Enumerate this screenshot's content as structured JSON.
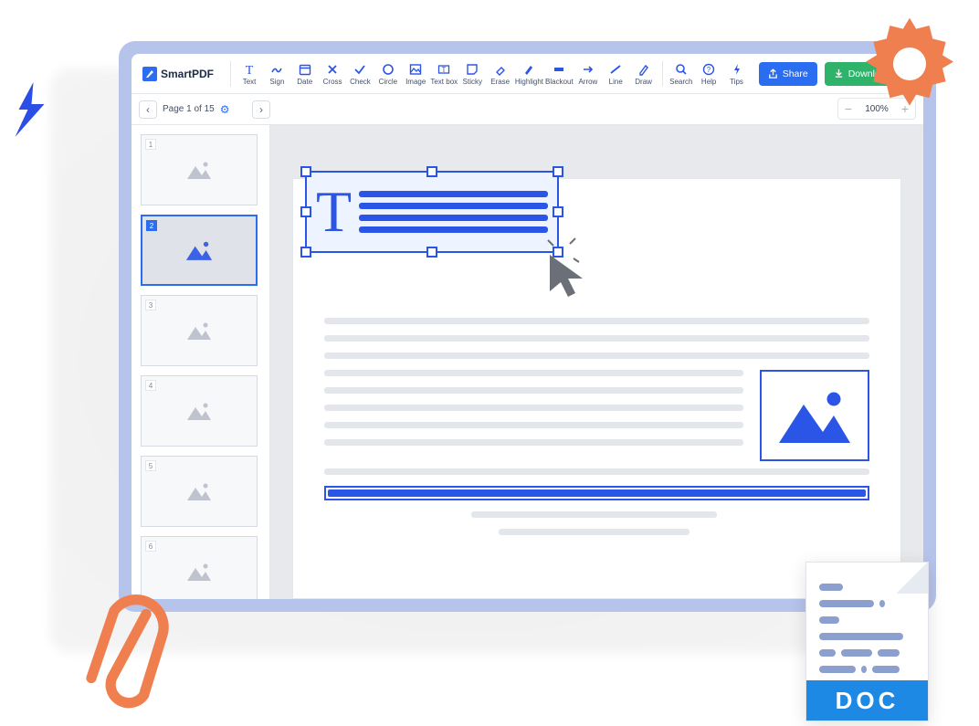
{
  "brand": {
    "name": "SmartPDF"
  },
  "toolbar": {
    "tools": [
      {
        "id": "text",
        "label": "Text"
      },
      {
        "id": "sign",
        "label": "Sign"
      },
      {
        "id": "date",
        "label": "Date"
      },
      {
        "id": "cross",
        "label": "Cross"
      },
      {
        "id": "check",
        "label": "Check"
      },
      {
        "id": "circle",
        "label": "Circle"
      },
      {
        "id": "image",
        "label": "Image"
      },
      {
        "id": "textbox",
        "label": "Text box"
      },
      {
        "id": "sticky",
        "label": "Sticky"
      },
      {
        "id": "erase",
        "label": "Erase"
      },
      {
        "id": "highlight",
        "label": "Highlight"
      },
      {
        "id": "blackout",
        "label": "Blackout"
      },
      {
        "id": "arrow",
        "label": "Arrow"
      },
      {
        "id": "line",
        "label": "Line"
      },
      {
        "id": "draw",
        "label": "Draw"
      }
    ],
    "help": [
      {
        "id": "search",
        "label": "Search"
      },
      {
        "id": "help",
        "label": "Help"
      },
      {
        "id": "tips",
        "label": "Tips"
      }
    ],
    "share": "Share",
    "download": "Download pdf"
  },
  "pager": {
    "label": "Page 1 of 15"
  },
  "zoom": {
    "value": "100%"
  },
  "thumbs": [
    {
      "num": "1"
    },
    {
      "num": "2"
    },
    {
      "num": "3"
    },
    {
      "num": "4"
    },
    {
      "num": "5"
    },
    {
      "num": "6"
    }
  ],
  "doc_badge": {
    "label": "DOC"
  }
}
